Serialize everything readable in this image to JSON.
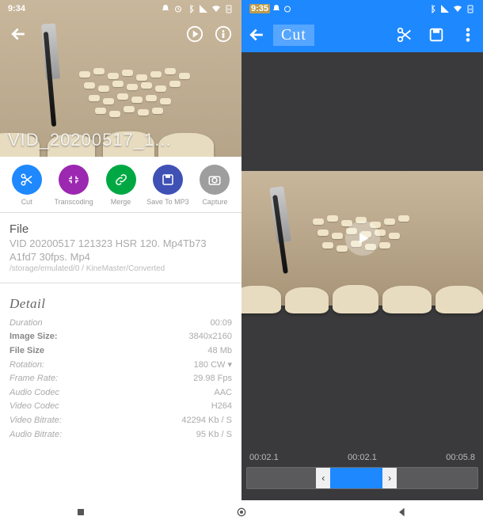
{
  "left": {
    "status_time": "9:34",
    "video_overlay_title": "VID_20200517_1...",
    "actions": [
      {
        "label": "Cut",
        "icon": "scissors",
        "color": "c-blue"
      },
      {
        "label": "Transcoding",
        "icon": "compress",
        "color": "c-purple"
      },
      {
        "label": "Merge",
        "icon": "link",
        "color": "c-green"
      },
      {
        "label": "Save To MP3",
        "icon": "save",
        "color": "c-indigo"
      },
      {
        "label": "Capture",
        "icon": "camera",
        "color": "c-grey"
      }
    ],
    "file_heading": "File",
    "filename": "VID 20200517 121323 HSR 120. Mp4Tb73 A1fd7 30fps. Mp4",
    "filepath": "/storage/emulated/0 / KineMaster/Converted",
    "detail_heading": "Detail",
    "details": [
      {
        "k": "Duration",
        "v": "00:09",
        "strong": false
      },
      {
        "k": "Image Size:",
        "v": "3840x2160",
        "strong": true
      },
      {
        "k": "File Size",
        "v": "48 Mb",
        "strong": true
      },
      {
        "k": "Rotation:",
        "v": "180 CW ▾",
        "strong": false
      },
      {
        "k": "Frame Rate:",
        "v": "29.98 Fps",
        "strong": false
      },
      {
        "k": "Audio Codec",
        "v": "AAC",
        "strong": false
      },
      {
        "k": "Video Codec",
        "v": "H264",
        "strong": false
      },
      {
        "k": "Video Bitrate:",
        "v": "42294 Kb / S",
        "strong": false
      },
      {
        "k": "Audio Bitrate:",
        "v": "95 Kb / S",
        "strong": false
      }
    ]
  },
  "right": {
    "status_time": "9:35",
    "title": "Cut",
    "timeline": {
      "t1": "00:02.1",
      "t2": "00:02.1",
      "t3": "00:05.8"
    }
  },
  "status_icons": [
    "bell-off",
    "alarm",
    "bt",
    "signal",
    "wifi",
    "battery"
  ]
}
